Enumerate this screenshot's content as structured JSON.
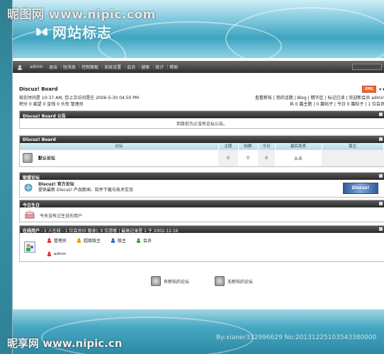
{
  "watermark_top": "昵图网 www.nipic.com",
  "watermark_bottom": "昵享网 www.nipic.cn",
  "watermark_id": "By:xianer332996629 No:20131225103543380000",
  "banner": {
    "logo_text": "网站标志"
  },
  "topbar": {
    "items": [
      "admin",
      "退出",
      "短消息",
      "控制面板",
      "系统设置",
      "会员",
      "搜索",
      "统计",
      "帮助"
    ]
  },
  "page": {
    "title": "Discuz! Board",
    "xml_badge": "XML",
    "time_line": "现在时间是 10:37 AM, 您上次访问是在 2006-5-30 04:50 PM",
    "stats_line": "积分 0 威望 0 金钱 0 头衔 管理员",
    "right_links": "查看新帖 | 我的话题 | Blog | 精华区 | 标记已读 | 欢迎新会员 admin",
    "right_stats": "共 0 篇主题 | 0 篇帖子 | 今日 0 篇帖子 | 1 位会员"
  },
  "notice": {
    "header": "Discuz! Board 公告",
    "body": "到目前为止没有论坛公告。"
  },
  "board": {
    "header": "Discuz! Board",
    "columns": [
      "论坛",
      "主题",
      "帖数",
      "今日",
      "最后发表",
      "版主"
    ],
    "rows": [
      {
        "name": "默认论坛",
        "topics": "0",
        "posts": "0",
        "today": "0",
        "last": "从未",
        "mod": ""
      }
    ]
  },
  "league": {
    "header": "联盟论坛",
    "name": "Discuz! 官方论坛",
    "desc": "提供最新 Discuz! 产品新闻、软件下载与技术交流",
    "logo_text": "Discuz!"
  },
  "birthday": {
    "header": "今日生日",
    "body": "今天没有过生日的用户"
  },
  "online": {
    "header_prefix": "在线用户",
    "header_text": "- 1 人在线 - 1 位会员(0 隐身), 0 位游客 | 最高记录是 1 于 2002-12-16",
    "groups": [
      "管理员",
      "超级版主",
      "版主",
      "会员"
    ],
    "users": [
      "admin"
    ]
  },
  "legend": {
    "new_posts": "有新帖的论坛",
    "no_new_posts": "无新帖的论坛"
  },
  "colors": {
    "accent": "#3a94a8",
    "bar_dark": "#2b2b2b",
    "table_header": "#b7dbe8",
    "xml_badge": "#f26a1b"
  }
}
